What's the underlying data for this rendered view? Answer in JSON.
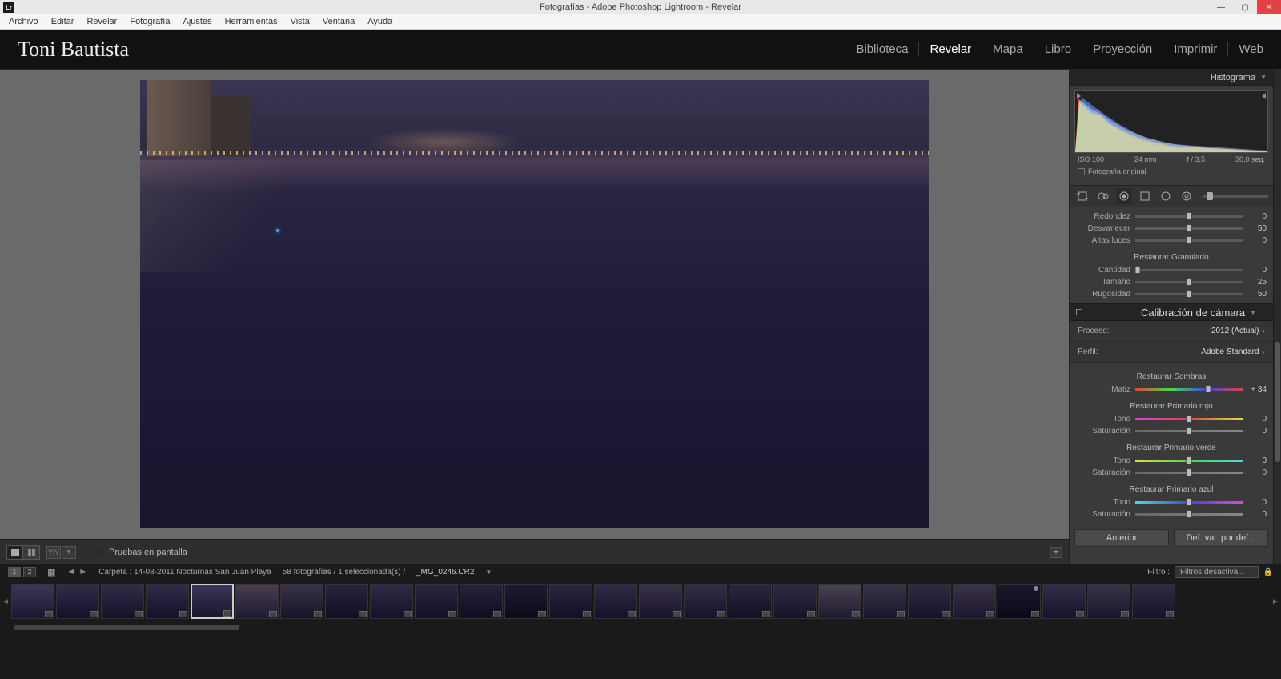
{
  "titlebar": {
    "app_icon": "Lr",
    "title": "Fotografías - Adobe Photoshop Lightroom - Revelar"
  },
  "menubar": [
    "Archivo",
    "Editar",
    "Revelar",
    "Fotografía",
    "Ajustes",
    "Herramientas",
    "Vista",
    "Ventana",
    "Ayuda"
  ],
  "identity": {
    "name": "Toni Bautista",
    "modules": [
      {
        "label": "Biblioteca",
        "active": false
      },
      {
        "label": "Revelar",
        "active": true
      },
      {
        "label": "Mapa",
        "active": false
      },
      {
        "label": "Libro",
        "active": false
      },
      {
        "label": "Proyección",
        "active": false
      },
      {
        "label": "Imprimir",
        "active": false
      },
      {
        "label": "Web",
        "active": false
      }
    ]
  },
  "canvas_toolbar": {
    "softproof_label": "Pruebas en pantalla"
  },
  "right": {
    "histogram_title": "Histograma",
    "histo_info": {
      "iso": "ISO 100",
      "focal": "24 mm",
      "aperture": "f / 3,5",
      "shutter": "30,0 seg."
    },
    "original_label": "Fotografía original",
    "effects": {
      "rows": [
        {
          "label": "Redondez",
          "value": "0",
          "pos": 50
        },
        {
          "label": "Desvanecer",
          "value": "50",
          "pos": 50
        },
        {
          "label": "Altas luces",
          "value": "0",
          "pos": 50
        }
      ],
      "grain_title": "Restaurar Granulado",
      "grain_rows": [
        {
          "label": "Cantidad",
          "value": "0",
          "pos": 2
        },
        {
          "label": "Tamaño",
          "value": "25",
          "pos": 50
        },
        {
          "label": "Rugosidad",
          "value": "50",
          "pos": 50
        }
      ]
    },
    "calibration": {
      "title": "Calibración de cámara",
      "process_label": "Proceso:",
      "process_value": "2012 (Actual)",
      "profile_label": "Perfil:",
      "profile_value": "Adobe Standard",
      "shadows_title": "Restaurar Sombras",
      "shadows_row": {
        "label": "Matiz",
        "value": "+ 34",
        "pos": 68
      },
      "red_title": "Restaurar Primario rojo",
      "red_rows": [
        {
          "label": "Tono",
          "value": "0",
          "pos": 50,
          "track": "red-hue"
        },
        {
          "label": "Saturación",
          "value": "0",
          "pos": 50,
          "track": "sat"
        }
      ],
      "green_title": "Restaurar Primario verde",
      "green_rows": [
        {
          "label": "Tono",
          "value": "0",
          "pos": 50,
          "track": "green-hue"
        },
        {
          "label": "Saturación",
          "value": "0",
          "pos": 50,
          "track": "sat"
        }
      ],
      "blue_title": "Restaurar Primario azul",
      "blue_rows": [
        {
          "label": "Tono",
          "value": "0",
          "pos": 50,
          "track": "blue-hue"
        },
        {
          "label": "Saturación",
          "value": "0",
          "pos": 50,
          "track": "sat"
        }
      ]
    },
    "buttons": {
      "prev": "Anterior",
      "reset": "Def. val. por def..."
    }
  },
  "infobar": {
    "folder": "Carpeta : 14-08-2011 Nocturnas San Juan Playa",
    "count": "58 fotografías / 1 seleccionada(s) /",
    "filename": "_MG_0246.CR2",
    "filter_label": "Filtro :",
    "filter_value": "Filtros desactiva..."
  },
  "filmstrip": {
    "thumbs": [
      {
        "bg": "linear-gradient(#3a3856,#1a1830)",
        "selected": false
      },
      {
        "bg": "linear-gradient(#2e2c48,#141228)",
        "selected": false
      },
      {
        "bg": "linear-gradient(#2e2c48,#141228)",
        "selected": false
      },
      {
        "bg": "linear-gradient(#2e2c48,#141228)",
        "selected": false
      },
      {
        "bg": "linear-gradient(#3a3556,#18162e)",
        "selected": true
      },
      {
        "bg": "linear-gradient(#4a3e50,#1e1a34)",
        "selected": false
      },
      {
        "bg": "linear-gradient(#3a3248,#16142a)",
        "selected": false
      },
      {
        "bg": "linear-gradient(#282440,#100e20)",
        "selected": false
      },
      {
        "bg": "linear-gradient(#302a44,#141228)",
        "selected": false
      },
      {
        "bg": "linear-gradient(#2a2640,#121024)",
        "selected": false
      },
      {
        "bg": "linear-gradient(#26223c,#100e20)",
        "selected": false
      },
      {
        "bg": "linear-gradient(#1e1a34,#0c0a18)",
        "selected": false
      },
      {
        "bg": "linear-gradient(#2a2640,#121024)",
        "selected": false
      },
      {
        "bg": "linear-gradient(#302a44,#141228)",
        "selected": false
      },
      {
        "bg": "linear-gradient(#3a3248,#18142c)",
        "selected": false
      },
      {
        "bg": "linear-gradient(#342e48,#16122a)",
        "selected": false
      },
      {
        "bg": "linear-gradient(#2a2640,#121024)",
        "selected": false
      },
      {
        "bg": "linear-gradient(#2e2a44,#141228)",
        "selected": false
      },
      {
        "bg": "linear-gradient(#4a4250,#201a30)",
        "selected": false
      },
      {
        "bg": "linear-gradient(#3a3448,#18142c)",
        "selected": false
      },
      {
        "bg": "linear-gradient(#2e2a44,#141228)",
        "selected": false
      },
      {
        "bg": "linear-gradient(#3c3448,#1a162e)",
        "selected": false
      },
      {
        "bg": "linear-gradient(#1a1830,#0a0818)",
        "selected": false,
        "mark": true
      },
      {
        "bg": "linear-gradient(#342e48,#16122a)",
        "selected": false
      },
      {
        "bg": "linear-gradient(#3a3448,#18142c)",
        "selected": false
      },
      {
        "bg": "linear-gradient(#302a44,#141228)",
        "selected": false
      }
    ]
  }
}
